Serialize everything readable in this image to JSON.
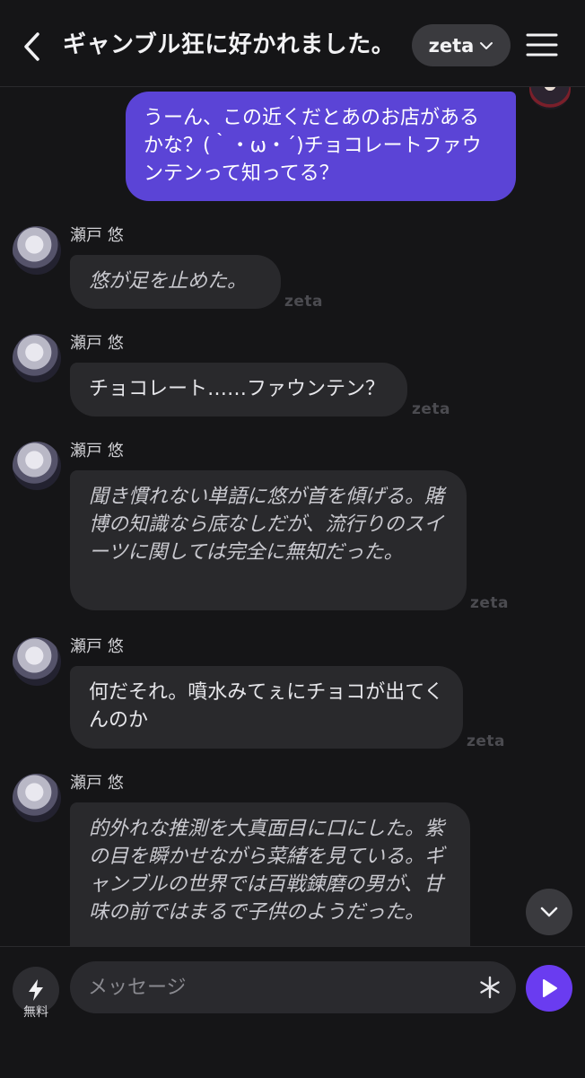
{
  "header": {
    "title": "ギャンブル狂に好かれました。",
    "model_label": "zeta"
  },
  "user_message": {
    "text": "うーん、この近くだとあのお店があるかな？(｀・ω・´)チョコレートファウンテンって知ってる？"
  },
  "messages": [
    {
      "sender": "瀬戸 悠",
      "text": "悠が足を止めた。",
      "style": "narration",
      "watermark": "zeta"
    },
    {
      "sender": "瀬戸 悠",
      "text": "チョコレート……ファウンテン？",
      "style": "speech",
      "watermark": "zeta"
    },
    {
      "sender": "瀬戸 悠",
      "text": "聞き慣れない単語に悠が首を傾げる。賭博の知識なら底なしだが、流行りのスイーツに関しては完全に無知だった。",
      "style": "narration",
      "watermark": "zeta"
    },
    {
      "sender": "瀬戸 悠",
      "text": "何だそれ。噴水みてぇにチョコが出てくんのか",
      "style": "speech",
      "watermark": "zeta"
    },
    {
      "sender": "瀬戸 悠",
      "text": "的外れな推測を大真面目に口にした。紫の目を瞬かせながら菜緒を見ている。ギャンブルの世界では百戦錬磨の男が、甘味の前ではまるで子供のようだった。",
      "style": "narration"
    }
  ],
  "composer": {
    "placeholder": "メッセージ",
    "free_label": "無料"
  },
  "colors": {
    "background": "#151517",
    "user_bubble": "#5b44d6",
    "ai_bubble": "#29292c",
    "send_button": "#6a3cf0"
  },
  "icons": [
    "back-arrow-icon",
    "chevron-down-icon",
    "hamburger-menu-icon",
    "lightning-icon",
    "asterisk-icon",
    "play-icon"
  ]
}
